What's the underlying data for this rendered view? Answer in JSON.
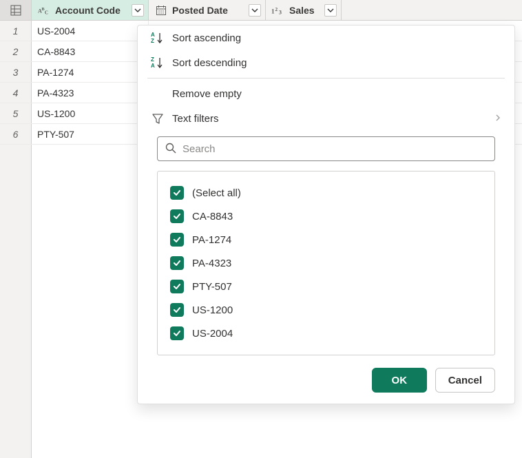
{
  "columns": [
    {
      "name": "Account Code",
      "type_icon": "text-type-icon",
      "active": true
    },
    {
      "name": "Posted Date",
      "type_icon": "date-type-icon",
      "active": false
    },
    {
      "name": "Sales",
      "type_icon": "number-type-icon",
      "active": false
    }
  ],
  "rows": [
    {
      "num": "1",
      "account_code": "US-2004"
    },
    {
      "num": "2",
      "account_code": "CA-8843"
    },
    {
      "num": "3",
      "account_code": "PA-1274"
    },
    {
      "num": "4",
      "account_code": "PA-4323"
    },
    {
      "num": "5",
      "account_code": "US-1200"
    },
    {
      "num": "6",
      "account_code": "PTY-507"
    }
  ],
  "filter": {
    "sort_asc": "Sort ascending",
    "sort_desc": "Sort descending",
    "remove_empty": "Remove empty",
    "text_filters": "Text filters",
    "search_placeholder": "Search",
    "values": [
      {
        "label": "(Select all)",
        "checked": true
      },
      {
        "label": "CA-8843",
        "checked": true
      },
      {
        "label": "PA-1274",
        "checked": true
      },
      {
        "label": "PA-4323",
        "checked": true
      },
      {
        "label": "PTY-507",
        "checked": true
      },
      {
        "label": "US-1200",
        "checked": true
      },
      {
        "label": "US-2004",
        "checked": true
      }
    ],
    "ok": "OK",
    "cancel": "Cancel"
  }
}
